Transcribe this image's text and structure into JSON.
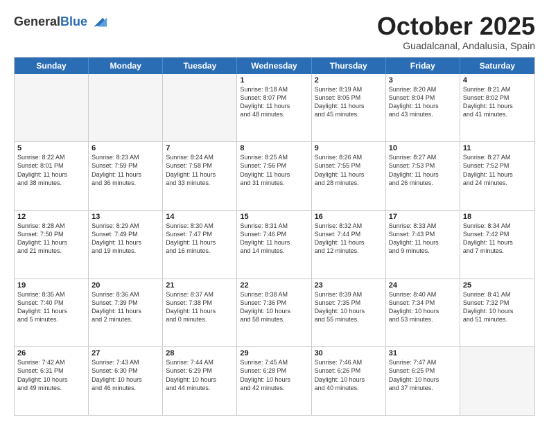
{
  "header": {
    "logo_general": "General",
    "logo_blue": "Blue",
    "month_title": "October 2025",
    "location": "Guadalcanal, Andalusia, Spain"
  },
  "days_of_week": [
    "Sunday",
    "Monday",
    "Tuesday",
    "Wednesday",
    "Thursday",
    "Friday",
    "Saturday"
  ],
  "weeks": [
    [
      {
        "day": "",
        "empty": true
      },
      {
        "day": "",
        "empty": true
      },
      {
        "day": "",
        "empty": true
      },
      {
        "day": "1",
        "lines": [
          "Sunrise: 8:18 AM",
          "Sunset: 8:07 PM",
          "Daylight: 11 hours",
          "and 48 minutes."
        ]
      },
      {
        "day": "2",
        "lines": [
          "Sunrise: 8:19 AM",
          "Sunset: 8:05 PM",
          "Daylight: 11 hours",
          "and 45 minutes."
        ]
      },
      {
        "day": "3",
        "lines": [
          "Sunrise: 8:20 AM",
          "Sunset: 8:04 PM",
          "Daylight: 11 hours",
          "and 43 minutes."
        ]
      },
      {
        "day": "4",
        "lines": [
          "Sunrise: 8:21 AM",
          "Sunset: 8:02 PM",
          "Daylight: 11 hours",
          "and 41 minutes."
        ]
      }
    ],
    [
      {
        "day": "5",
        "lines": [
          "Sunrise: 8:22 AM",
          "Sunset: 8:01 PM",
          "Daylight: 11 hours",
          "and 38 minutes."
        ]
      },
      {
        "day": "6",
        "lines": [
          "Sunrise: 8:23 AM",
          "Sunset: 7:59 PM",
          "Daylight: 11 hours",
          "and 36 minutes."
        ]
      },
      {
        "day": "7",
        "lines": [
          "Sunrise: 8:24 AM",
          "Sunset: 7:58 PM",
          "Daylight: 11 hours",
          "and 33 minutes."
        ]
      },
      {
        "day": "8",
        "lines": [
          "Sunrise: 8:25 AM",
          "Sunset: 7:56 PM",
          "Daylight: 11 hours",
          "and 31 minutes."
        ]
      },
      {
        "day": "9",
        "lines": [
          "Sunrise: 8:26 AM",
          "Sunset: 7:55 PM",
          "Daylight: 11 hours",
          "and 28 minutes."
        ]
      },
      {
        "day": "10",
        "lines": [
          "Sunrise: 8:27 AM",
          "Sunset: 7:53 PM",
          "Daylight: 11 hours",
          "and 26 minutes."
        ]
      },
      {
        "day": "11",
        "lines": [
          "Sunrise: 8:27 AM",
          "Sunset: 7:52 PM",
          "Daylight: 11 hours",
          "and 24 minutes."
        ]
      }
    ],
    [
      {
        "day": "12",
        "lines": [
          "Sunrise: 8:28 AM",
          "Sunset: 7:50 PM",
          "Daylight: 11 hours",
          "and 21 minutes."
        ]
      },
      {
        "day": "13",
        "lines": [
          "Sunrise: 8:29 AM",
          "Sunset: 7:49 PM",
          "Daylight: 11 hours",
          "and 19 minutes."
        ]
      },
      {
        "day": "14",
        "lines": [
          "Sunrise: 8:30 AM",
          "Sunset: 7:47 PM",
          "Daylight: 11 hours",
          "and 16 minutes."
        ]
      },
      {
        "day": "15",
        "lines": [
          "Sunrise: 8:31 AM",
          "Sunset: 7:46 PM",
          "Daylight: 11 hours",
          "and 14 minutes."
        ]
      },
      {
        "day": "16",
        "lines": [
          "Sunrise: 8:32 AM",
          "Sunset: 7:44 PM",
          "Daylight: 11 hours",
          "and 12 minutes."
        ]
      },
      {
        "day": "17",
        "lines": [
          "Sunrise: 8:33 AM",
          "Sunset: 7:43 PM",
          "Daylight: 11 hours",
          "and 9 minutes."
        ]
      },
      {
        "day": "18",
        "lines": [
          "Sunrise: 8:34 AM",
          "Sunset: 7:42 PM",
          "Daylight: 11 hours",
          "and 7 minutes."
        ]
      }
    ],
    [
      {
        "day": "19",
        "lines": [
          "Sunrise: 8:35 AM",
          "Sunset: 7:40 PM",
          "Daylight: 11 hours",
          "and 5 minutes."
        ]
      },
      {
        "day": "20",
        "lines": [
          "Sunrise: 8:36 AM",
          "Sunset: 7:39 PM",
          "Daylight: 11 hours",
          "and 2 minutes."
        ]
      },
      {
        "day": "21",
        "lines": [
          "Sunrise: 8:37 AM",
          "Sunset: 7:38 PM",
          "Daylight: 11 hours",
          "and 0 minutes."
        ]
      },
      {
        "day": "22",
        "lines": [
          "Sunrise: 8:38 AM",
          "Sunset: 7:36 PM",
          "Daylight: 10 hours",
          "and 58 minutes."
        ]
      },
      {
        "day": "23",
        "lines": [
          "Sunrise: 8:39 AM",
          "Sunset: 7:35 PM",
          "Daylight: 10 hours",
          "and 55 minutes."
        ]
      },
      {
        "day": "24",
        "lines": [
          "Sunrise: 8:40 AM",
          "Sunset: 7:34 PM",
          "Daylight: 10 hours",
          "and 53 minutes."
        ]
      },
      {
        "day": "25",
        "lines": [
          "Sunrise: 8:41 AM",
          "Sunset: 7:32 PM",
          "Daylight: 10 hours",
          "and 51 minutes."
        ]
      }
    ],
    [
      {
        "day": "26",
        "lines": [
          "Sunrise: 7:42 AM",
          "Sunset: 6:31 PM",
          "Daylight: 10 hours",
          "and 49 minutes."
        ]
      },
      {
        "day": "27",
        "lines": [
          "Sunrise: 7:43 AM",
          "Sunset: 6:30 PM",
          "Daylight: 10 hours",
          "and 46 minutes."
        ]
      },
      {
        "day": "28",
        "lines": [
          "Sunrise: 7:44 AM",
          "Sunset: 6:29 PM",
          "Daylight: 10 hours",
          "and 44 minutes."
        ]
      },
      {
        "day": "29",
        "lines": [
          "Sunrise: 7:45 AM",
          "Sunset: 6:28 PM",
          "Daylight: 10 hours",
          "and 42 minutes."
        ]
      },
      {
        "day": "30",
        "lines": [
          "Sunrise: 7:46 AM",
          "Sunset: 6:26 PM",
          "Daylight: 10 hours",
          "and 40 minutes."
        ]
      },
      {
        "day": "31",
        "lines": [
          "Sunrise: 7:47 AM",
          "Sunset: 6:25 PM",
          "Daylight: 10 hours",
          "and 37 minutes."
        ]
      },
      {
        "day": "",
        "empty": true
      }
    ]
  ]
}
